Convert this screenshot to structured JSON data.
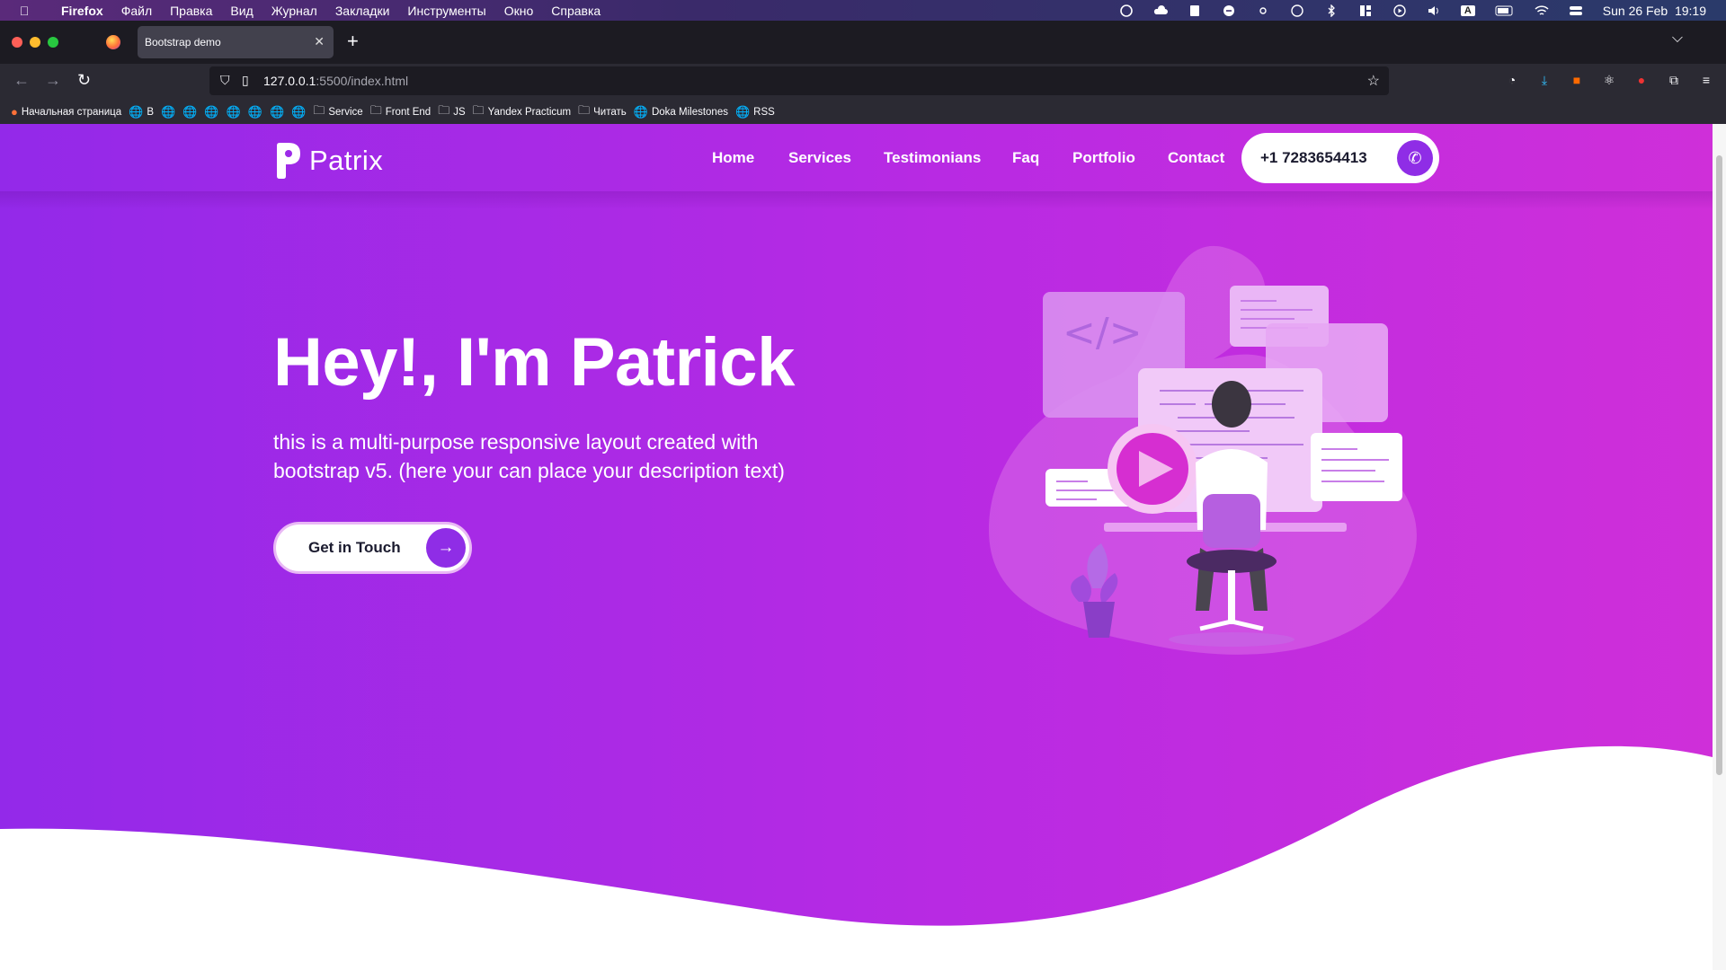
{
  "menubar": {
    "app": "Firefox",
    "items": [
      "Файл",
      "Правка",
      "Вид",
      "Журнал",
      "Закладки",
      "Инструменты",
      "Окно",
      "Справка"
    ],
    "input_source": "A",
    "datetime": "Sun 26 Feb  19:19"
  },
  "browser": {
    "tab_title": "Bootstrap demo",
    "url_host": "127.0.0.1",
    "url_path": ":5500/index.html",
    "bookmarks": [
      {
        "label": "Начальная страница",
        "icon": "firefox-icon"
      },
      {
        "label": "В",
        "icon": "globe-icon"
      },
      {
        "label": "",
        "icon": "globe-icon"
      },
      {
        "label": "",
        "icon": "globe-icon"
      },
      {
        "label": "",
        "icon": "globe-icon"
      },
      {
        "label": "",
        "icon": "globe-icon"
      },
      {
        "label": "",
        "icon": "globe-icon"
      },
      {
        "label": "",
        "icon": "globe-icon"
      },
      {
        "label": "",
        "icon": "globe-icon"
      },
      {
        "label": "Service",
        "icon": "folder-icon"
      },
      {
        "label": "Front End",
        "icon": "folder-icon"
      },
      {
        "label": "JS",
        "icon": "folder-icon"
      },
      {
        "label": "Yandex Practicum",
        "icon": "folder-icon"
      },
      {
        "label": "Читать",
        "icon": "folder-icon"
      },
      {
        "label": "Doka Milestones",
        "icon": "globe-icon"
      },
      {
        "label": "RSS",
        "icon": "globe-icon"
      }
    ]
  },
  "site": {
    "logo_text": "Patrix",
    "nav": [
      "Home",
      "Services",
      "Testimonians",
      "Faq",
      "Portfolio",
      "Contact"
    ],
    "phone": "+1 7283654413",
    "headline": "Hey!, I'm Patrick",
    "description": "this is a multi-purpose responsive layout created with bootstrap v5. (here your can place your description text)",
    "cta_label": "Get in Touch",
    "illustration_code_symbol": "</>"
  },
  "colors": {
    "hero_start": "#9329e9",
    "hero_end": "#cf2fd9",
    "accent": "#8f2de6"
  }
}
